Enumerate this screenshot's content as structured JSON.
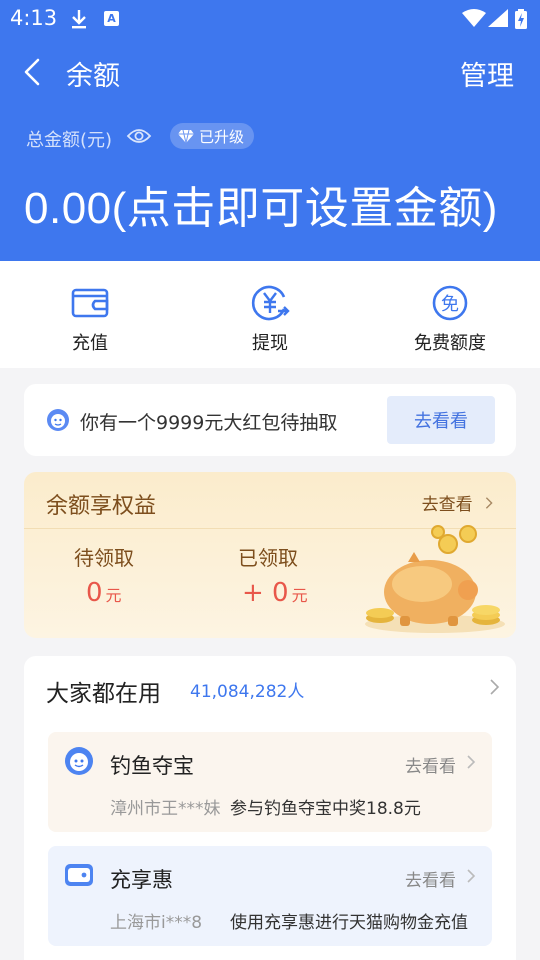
{
  "status_bar": {
    "time": "4:13",
    "icons": [
      "download-icon",
      "a-notification-icon",
      "wifi-icon",
      "signal-icon",
      "battery-charging-icon"
    ],
    "a_glyph": "A"
  },
  "header": {
    "title": "余额",
    "manage_label": "管理",
    "total_label": "总金额(元)",
    "upgrade_badge": "已升级",
    "amount_text": "0.00(点击即可设置金额)",
    "bg_color": "#3e77ee"
  },
  "actions": [
    {
      "label": "充值",
      "icon": "wallet-icon"
    },
    {
      "label": "提现",
      "icon": "yuan-withdraw-icon"
    },
    {
      "label": "免费额度",
      "icon": "free-icon"
    }
  ],
  "free_glyph": "免",
  "banner": {
    "text": "你有一个9999元大红包待抽取",
    "button_label": "去看看"
  },
  "rights": {
    "title": "余额享权益",
    "link_label": "去查看",
    "pending_label": "待领取",
    "pending_value": "0",
    "pending_unit": "元",
    "received_label": "已领取",
    "received_value": "+ 0",
    "received_unit": "元"
  },
  "popular": {
    "title": "大家都在用",
    "count": "41,084,282人",
    "items": [
      {
        "name": "钓鱼夺宝",
        "go_label": "去看看",
        "user": "漳州市王***妹",
        "desc": "参与钓鱼夺宝中奖18.8元",
        "bg": "#fbf5ee"
      },
      {
        "name": "充享惠",
        "go_label": "去看看",
        "user": "上海市i***8",
        "desc": "使用充享惠进行天猫购物金充值",
        "bg": "#eef3fd"
      }
    ]
  },
  "accent_color": "#3e77ee",
  "reward_color": "#e8574a"
}
